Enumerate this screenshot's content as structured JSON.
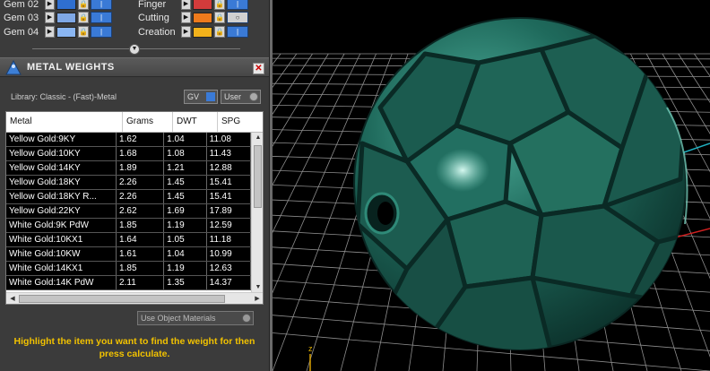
{
  "layers": [
    {
      "name": "Gem 02",
      "color": "#2f6fd0"
    },
    {
      "name": "Gem 03",
      "color": "#7fa8e6"
    },
    {
      "name": "Gem 04",
      "color": "#8ab6f2"
    }
  ],
  "layers_right": [
    {
      "name": "Finger",
      "color": "#d23b3b"
    },
    {
      "name": "Cutting",
      "color": "#ee7a1c"
    },
    {
      "name": "Creation",
      "color": "#f2b21b"
    }
  ],
  "metal_weights": {
    "title": "METAL WEIGHTS",
    "close": "✕",
    "library_label": "Library: Classic - (Fast)-Metal",
    "gv_label": "GV",
    "user_label": "User",
    "columns": [
      "Metal",
      "Grams",
      "DWT",
      "SPG"
    ],
    "rows": [
      [
        "Yellow Gold:9KY",
        "1.62",
        "1.04",
        "11.08"
      ],
      [
        "Yellow Gold:10KY",
        "1.68",
        "1.08",
        "11.43"
      ],
      [
        "Yellow Gold:14KY",
        "1.89",
        "1.21",
        "12.88"
      ],
      [
        "Yellow Gold:18KY",
        "2.26",
        "1.45",
        "15.41"
      ],
      [
        "Yellow Gold:18KY R...",
        "2.26",
        "1.45",
        "15.41"
      ],
      [
        "Yellow Gold:22KY",
        "2.62",
        "1.69",
        "17.89"
      ],
      [
        "White Gold:9K PdW",
        "1.85",
        "1.19",
        "12.59"
      ],
      [
        "White Gold:10KX1",
        "1.64",
        "1.05",
        "11.18"
      ],
      [
        "White Gold:10KW",
        "1.61",
        "1.04",
        "10.99"
      ],
      [
        "White Gold:14KX1",
        "1.85",
        "1.19",
        "12.63"
      ],
      [
        "White Gold:14K PdW",
        "2.11",
        "1.35",
        "14.37"
      ]
    ],
    "use_object_materials": "Use Object Materials",
    "hint": "Highlight the item you want to find the weight for then press calculate."
  },
  "viewport": {
    "axis_label": "z",
    "grid_color": "#9a9a9a",
    "ball_color": "#1f5e54"
  }
}
